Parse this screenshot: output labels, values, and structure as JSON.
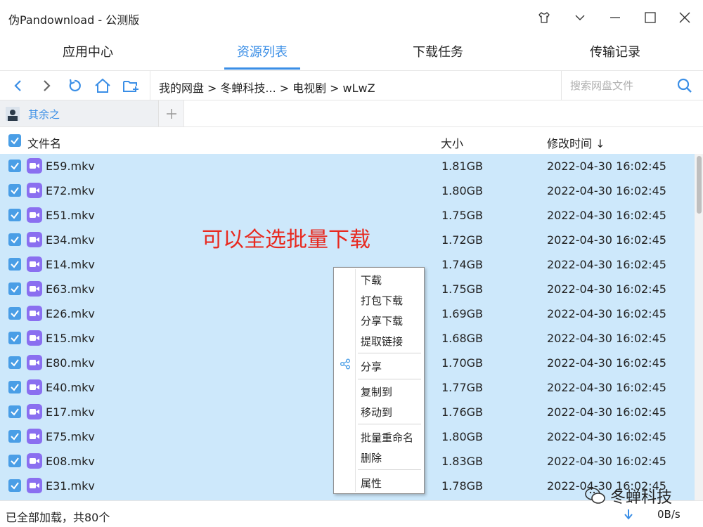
{
  "window": {
    "title": "伪Pandownload - 公测版"
  },
  "main_tabs": [
    {
      "label": "应用中心",
      "active": false
    },
    {
      "label": "资源列表",
      "active": true
    },
    {
      "label": "下载任务",
      "active": false
    },
    {
      "label": "传输记录",
      "active": false
    }
  ],
  "breadcrumb": [
    "我的网盘",
    ">",
    "冬蝉科技...",
    ">",
    "电视剧",
    ">",
    "wLwZ"
  ],
  "search": {
    "placeholder": "搜索网盘文件",
    "value": ""
  },
  "sub_tab": {
    "label": "其余之",
    "add_label": "+"
  },
  "columns": {
    "name": "文件名",
    "size": "大小",
    "modified": "修改时间 ↓"
  },
  "files": [
    {
      "name": "E59.mkv",
      "size": "1.81GB",
      "modified": "2022-04-30 16:02:45"
    },
    {
      "name": "E72.mkv",
      "size": "1.80GB",
      "modified": "2022-04-30 16:02:45"
    },
    {
      "name": "E51.mkv",
      "size": "1.75GB",
      "modified": "2022-04-30 16:02:45"
    },
    {
      "name": "E34.mkv",
      "size": "1.72GB",
      "modified": "2022-04-30 16:02:45"
    },
    {
      "name": "E14.mkv",
      "size": "1.74GB",
      "modified": "2022-04-30 16:02:45"
    },
    {
      "name": "E63.mkv",
      "size": "1.75GB",
      "modified": "2022-04-30 16:02:45"
    },
    {
      "name": "E26.mkv",
      "size": "1.69GB",
      "modified": "2022-04-30 16:02:45"
    },
    {
      "name": "E15.mkv",
      "size": "1.68GB",
      "modified": "2022-04-30 16:02:45"
    },
    {
      "name": "E80.mkv",
      "size": "1.70GB",
      "modified": "2022-04-30 16:02:45"
    },
    {
      "name": "E40.mkv",
      "size": "1.77GB",
      "modified": "2022-04-30 16:02:45"
    },
    {
      "name": "E17.mkv",
      "size": "1.76GB",
      "modified": "2022-04-30 16:02:45"
    },
    {
      "name": "E75.mkv",
      "size": "1.80GB",
      "modified": "2022-04-30 16:02:45"
    },
    {
      "name": "E08.mkv",
      "size": "1.83GB",
      "modified": "2022-04-30 16:02:45"
    },
    {
      "name": "E31.mkv",
      "size": "1.78GB",
      "modified": "2022-04-30 16:02:45"
    }
  ],
  "annotation": "可以全选批量下载",
  "context_menu": [
    {
      "label": "下载"
    },
    {
      "label": "打包下载"
    },
    {
      "label": "分享下载"
    },
    {
      "label": "提取链接"
    },
    {
      "label": "分享",
      "icon": "share-icon"
    },
    {
      "label": "复制到"
    },
    {
      "label": "移动到"
    },
    {
      "label": "批量重命名"
    },
    {
      "label": "删除"
    },
    {
      "label": "属性"
    }
  ],
  "status": {
    "text": "已全部加载，共80个",
    "speed": "0B/s"
  },
  "watermark": "冬蝉科技",
  "colors": {
    "accent": "#3a8ee6",
    "selection": "#cde8fb",
    "file_icon": "#8a6ff0",
    "annotation": "#e8291f"
  }
}
